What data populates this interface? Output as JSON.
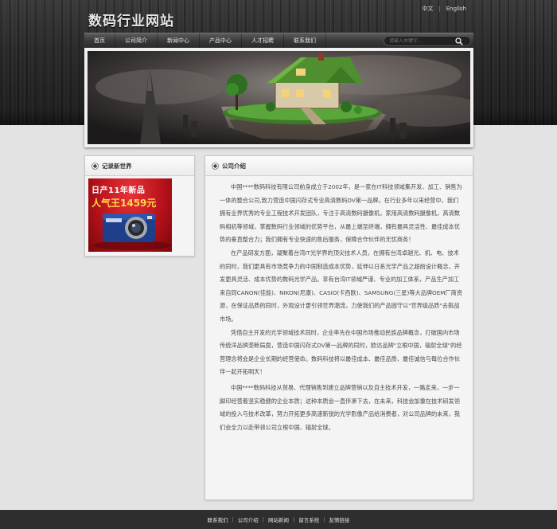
{
  "header": {
    "site_title": "数码行业网站",
    "lang_cn": "中文",
    "lang_en": "English"
  },
  "nav": {
    "items": [
      "首页",
      "公司简介",
      "新闻中心",
      "产品中心",
      "人才招聘",
      "联系我们"
    ],
    "search_placeholder": "请输入关键字..."
  },
  "left_panel": {
    "title": "记录新世界",
    "promo_line1": "日产11年新品",
    "promo_line2": "人气王1459元"
  },
  "right_panel": {
    "title": "公司介绍",
    "paragraphs": [
      "中国****数码科技有限公司前身成立于2002年，是一家在IT科技领域集开发、加工、销售为一体的整合公司,致力营造中国闪存式专业高清数码DV第一品牌。在行业多年以来经营中，我们拥有业界优秀的专业工程技术开发团队，专注于高清数码摄像机，家用高清数码摄像机，高清数码相机等领域，掌握数码行业领域的优势平台，从最上端至终端，拥有最具灵活性、最佳成本优势的垂直整合力；我们拥有专业快速的售后服务，保障合作伙伴的无忧商务！",
      "在产品研发方面，凝聚着台湾IT光学界的顶尖技术人员，在拥有台湾卓越光、机、电、技术的同时，我们更具有市场竞争力的中国制造成本优势，延伸以日系光学产品之超前设计概念，开发更具灵活、成本优势的数码光学产品。享有台湾IT领域严谨、专业的加工体系，产品生产加工来自同CANON(佳能)、NIKON(尼康)、CASIO(卡西欧)、SAMSUNG(三星)等大品牌OEM厂商资源，在保证品质的同时，外观设计更引领世界潮流，力使我们的产品固守以\"世界级品质\"去挑战市场。",
      "凭借自主开发的光学领域技术同时，企业率先在中国市场推动民族品牌概念，打破国内市场传统洋品牌垄断局面，营造中国闪存式DV第一品牌的同时，欧达品牌\"立根中国，辐射全球\"的经营理念将会是企业长期的经营使命。数码科技将以最佳成本、最佳品质、最佳诚信与每位合作伙伴一起开拓明天！",
      "中国****数码科技从贸易、代理销售到建立品牌营销以及自主技术开发，一路走来，一步一脚印经营着坚实稳健的企业本质；这种本质会一直伴承下去，在未来，科技会加重在技术研发领域的投入与技术改革，努力开拓更多高速新锐的光学影像产品给消费者，对公司品牌的未来，我们会全力以赴带领公司立根中国、辐射全球。"
    ]
  },
  "footer": {
    "links": [
      "联系我们",
      "公司介绍",
      "网站新闻",
      "留言系统",
      "友情链接"
    ]
  },
  "colors": {
    "header_bg": "#2b2b2b",
    "body_bg": "#e3e3e3",
    "footer_bg": "#2e2e2e",
    "promo_red": "#b8121b",
    "promo_price": "#ffd94a"
  }
}
